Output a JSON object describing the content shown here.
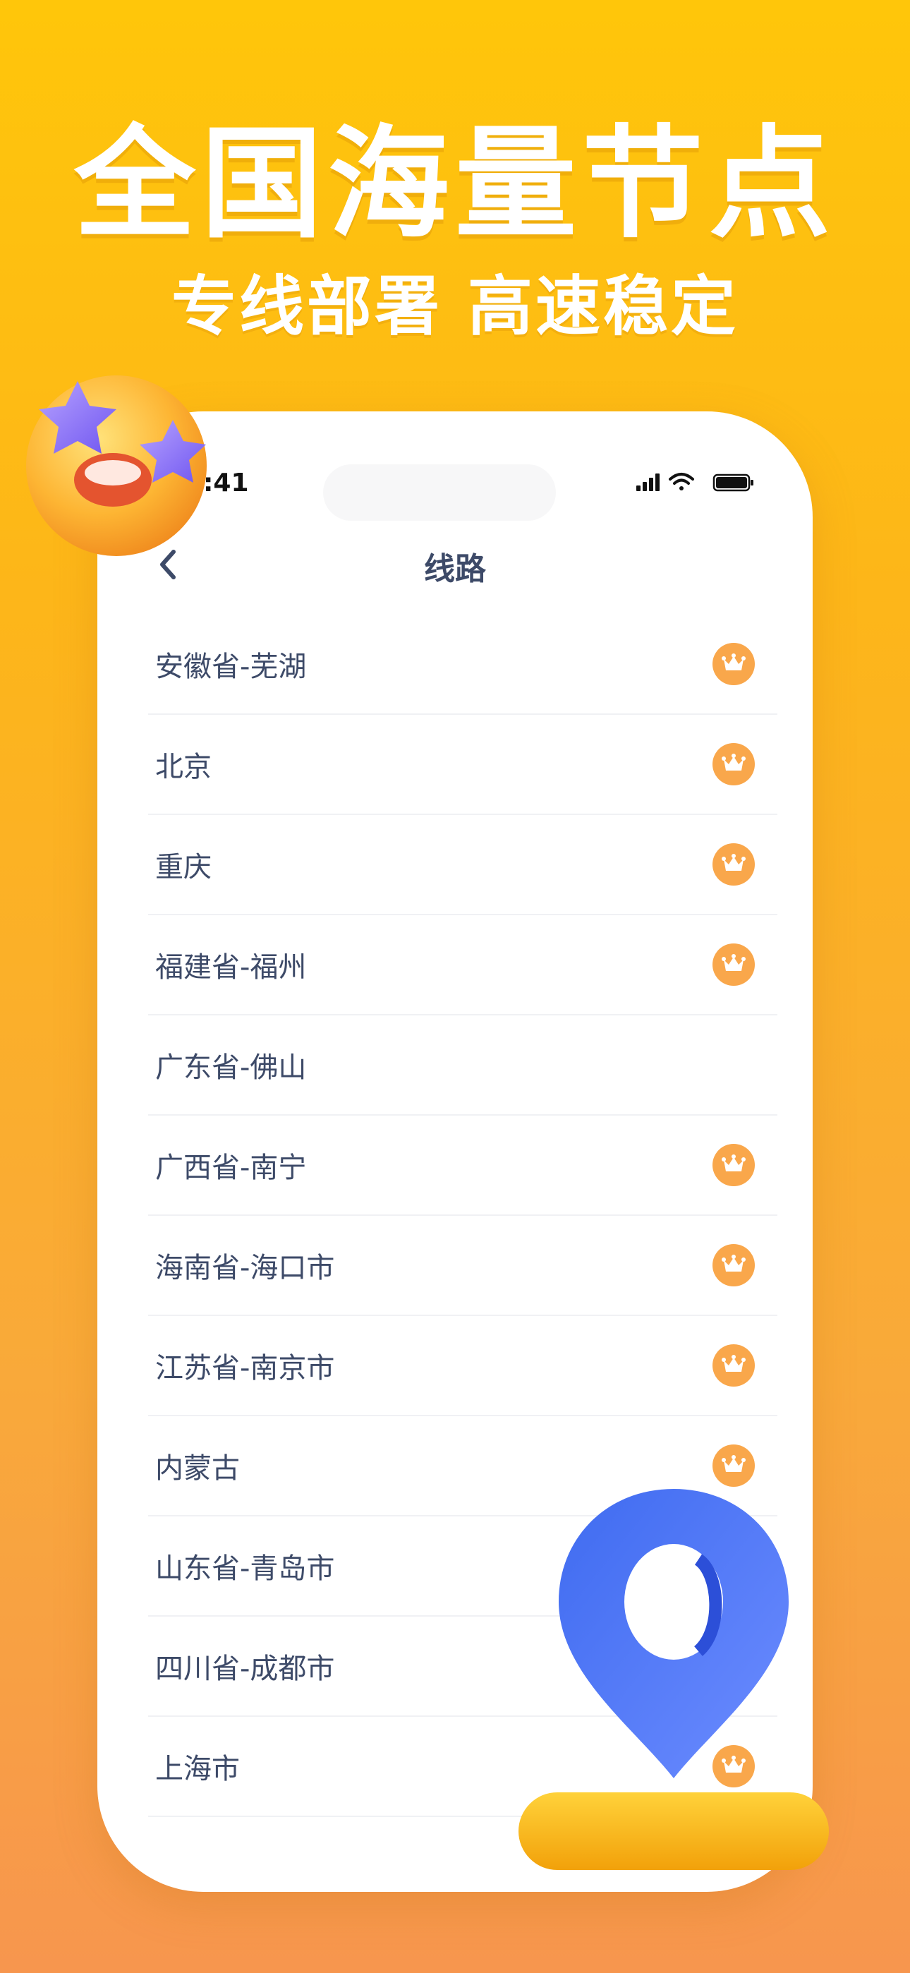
{
  "promo": {
    "headline": "全国海量节点",
    "subline": "专线部署 高速稳定"
  },
  "status_bar": {
    "time": ":41"
  },
  "nav": {
    "title": "线路"
  },
  "routes": [
    {
      "label": "安徽省-芜湖",
      "vip": true
    },
    {
      "label": "北京",
      "vip": true
    },
    {
      "label": "重庆",
      "vip": true
    },
    {
      "label": "福建省-福州",
      "vip": true
    },
    {
      "label": "广东省-佛山",
      "vip": false
    },
    {
      "label": "广西省-南宁",
      "vip": true
    },
    {
      "label": "海南省-海口市",
      "vip": true
    },
    {
      "label": "江苏省-南京市",
      "vip": true
    },
    {
      "label": "内蒙古",
      "vip": true
    },
    {
      "label": "山东省-青岛市",
      "vip": true
    },
    {
      "label": "四川省-成都市",
      "vip": true
    },
    {
      "label": "上海市",
      "vip": true
    }
  ],
  "icons": {
    "vip": "crown-icon",
    "back": "chevron-left-icon",
    "decor1": "star-eyes-emoji-icon",
    "decor2": "location-pin-icon"
  },
  "colors": {
    "bg_top": "#FFC60A",
    "bg_bottom": "#F7964E",
    "crown_badge": "#F9A74B",
    "text": "#3D4A68",
    "pin": "#4F72F5"
  }
}
